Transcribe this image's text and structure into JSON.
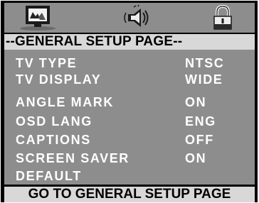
{
  "tabs": [
    {
      "icon": "monitor-icon",
      "active": true
    },
    {
      "icon": "speaker-icon",
      "active": false
    },
    {
      "icon": "lock-icon",
      "active": false
    }
  ],
  "page_title": "--GENERAL SETUP PAGE--",
  "menu": [
    {
      "label": "TV TYPE",
      "value": "NTSC"
    },
    {
      "label": "TV DISPLAY",
      "value": "WIDE"
    },
    {
      "label": "ANGLE MARK",
      "value": "ON"
    },
    {
      "label": "OSD LANG",
      "value": "ENG"
    },
    {
      "label": "CAPTIONS",
      "value": "OFF"
    },
    {
      "label": "SCREEN SAVER",
      "value": "ON"
    },
    {
      "label": "DEFAULT",
      "value": ""
    }
  ],
  "status_text": "GO TO GENERAL SETUP PAGE",
  "colors": {
    "frame": "#000000",
    "panel": "#8d8d8d",
    "bar": "#d8d8d8",
    "text": "#ffffff"
  }
}
